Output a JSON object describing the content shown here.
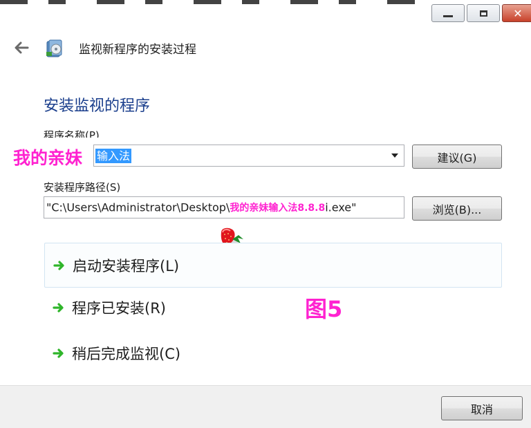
{
  "window": {
    "close_glyph": "✕",
    "controls": [
      "minimize-icon",
      "maximize-icon",
      "close-icon"
    ]
  },
  "header": {
    "title": "监视新程序的安装过程",
    "back_icon": "back-arrow-icon",
    "app_icon": "installer-monitor-icon"
  },
  "section": {
    "title": "安装监视的程序"
  },
  "program_name": {
    "label": "程序名称(P)",
    "overlay_text": "我的亲妹",
    "selected_value": "输入法",
    "suggest_button": "建议(G)"
  },
  "installer_path": {
    "label": "安装程序路径(S)",
    "value_prefix": "\"C:\\Users\\Administrator\\Desktop\\",
    "overlay_text": "我的亲妹输入法8.8.8",
    "value_suffix": "i.exe\"",
    "browse_button": "浏览(B)..."
  },
  "options": [
    {
      "label": "启动安装程序(L)",
      "icon": "green-arrow-icon"
    },
    {
      "label": "程序已安装(R)",
      "icon": "green-arrow-icon"
    },
    {
      "label": "稍后完成监视(C)",
      "icon": "green-arrow-icon"
    }
  ],
  "annotation": {
    "figure_label": "图5",
    "sticker": "strawberry-icon"
  },
  "footer": {
    "cancel_button": "取消"
  },
  "colors": {
    "section_title": "#1a3e8c",
    "overlay_pink": "#ff22d0",
    "selection_blue": "#3399ff",
    "arrow_green": "#2fb52a",
    "close_red": "#c8412a"
  }
}
